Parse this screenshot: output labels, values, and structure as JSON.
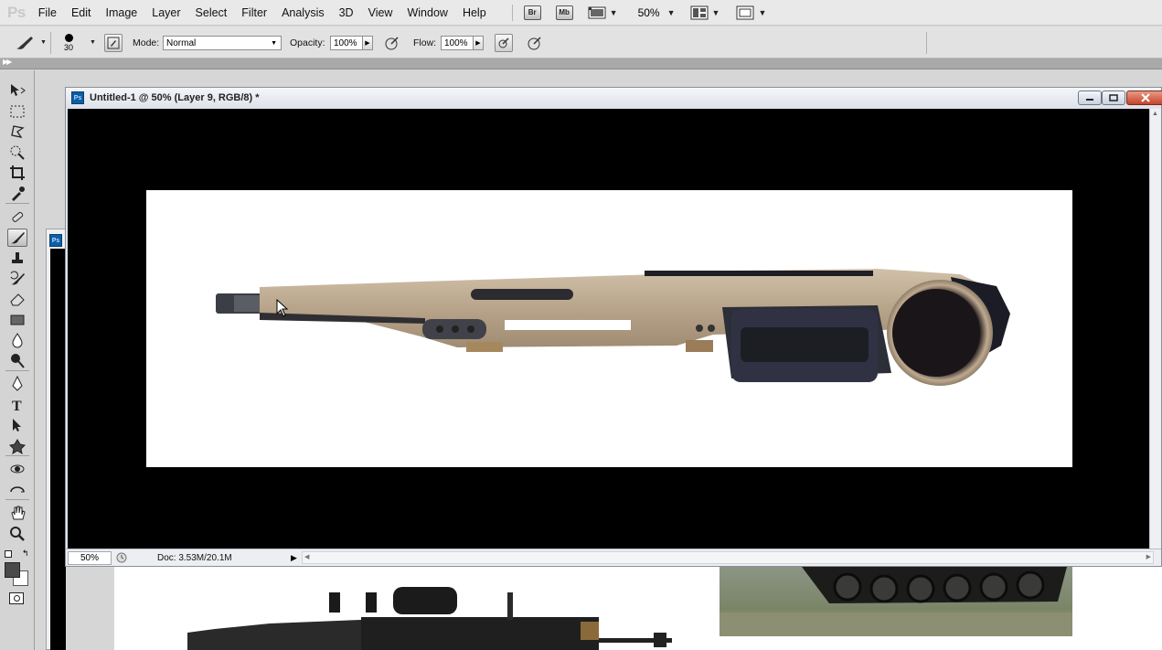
{
  "app": {
    "logo": "Ps",
    "menu": [
      "File",
      "Edit",
      "Image",
      "Layer",
      "Select",
      "Filter",
      "Analysis",
      "3D",
      "View",
      "Window",
      "Help"
    ],
    "top_buttons": {
      "bridge": "Br",
      "mini_bridge": "Mb"
    },
    "zoom": "50%"
  },
  "options": {
    "brush_size": "30",
    "mode_label": "Mode:",
    "mode_value": "Normal",
    "opacity_label": "Opacity:",
    "opacity_value": "100%",
    "flow_label": "Flow:",
    "flow_value": "100%"
  },
  "document": {
    "title": "Untitled-1 @ 50% (Layer 9, RGB/8) *",
    "status_zoom": "50%",
    "status_doc": "Doc: 3.53M/20.1M",
    "canvas_color": "#ffffff",
    "pasteboard_color": "#000000"
  },
  "tools": [
    "move-tool",
    "marquee-tool",
    "lasso-tool",
    "quick-selection-tool",
    "crop-tool",
    "eyedropper-tool",
    "spot-healing-tool",
    "brush-tool",
    "clone-stamp-tool",
    "history-brush-tool",
    "eraser-tool",
    "gradient-tool",
    "blur-tool",
    "dodge-tool",
    "pen-tool",
    "type-tool",
    "path-selection-tool",
    "shape-tool",
    "3d-rotate-tool",
    "3d-orbit-tool",
    "hand-tool",
    "zoom-tool"
  ],
  "colors": {
    "foreground": "#4a4a4a",
    "background": "#ffffff",
    "accent_ps": "#0b5fa5"
  }
}
